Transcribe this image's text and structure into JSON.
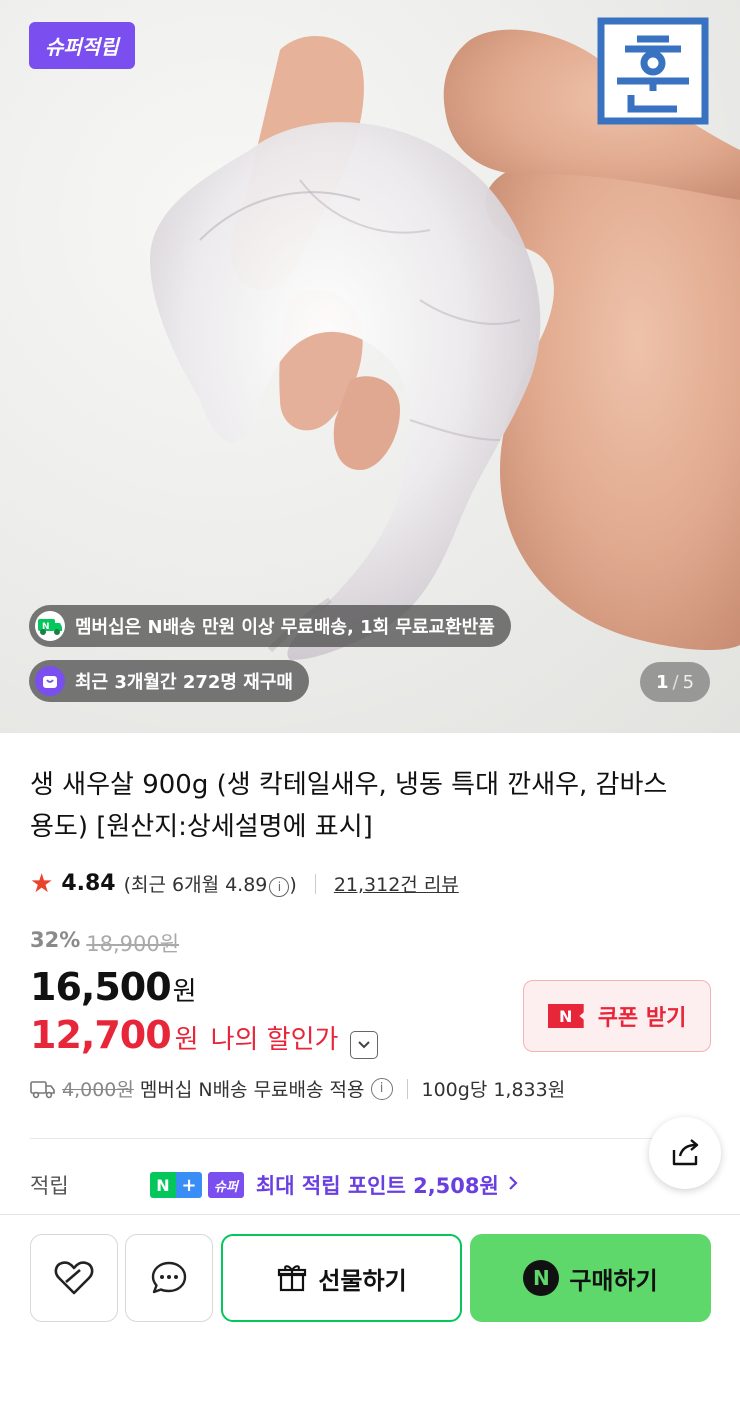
{
  "hero": {
    "badge": "슈퍼적립",
    "brand_logo_text": "훈",
    "pill_membership": "멤버십은 N배송 만원 이상 무료배송, 1회 무료교환반품",
    "pill_rebuy": "최근 3개월간 272명 재구매",
    "pager_current": "1",
    "pager_sep": "/",
    "pager_total": "5"
  },
  "product": {
    "title": "생 새우살 900g (생 칵테일새우, 냉동 특대 깐새우, 감바스용도) [원산지:상세설명에 표시]",
    "rating": "4.84",
    "recent_rating": "(최근 6개월 4.89",
    "recent_close": ")",
    "reviews": "21,312건 리뷰",
    "discount_pct": "32%",
    "original_price": "18,900원",
    "price": "16,500",
    "price_unit": "원",
    "my_price": "12,700",
    "my_price_unit": "원",
    "my_price_label": "나의 할인가",
    "coupon_button": "쿠폰 받기",
    "coupon_icon": "N",
    "ship_orig": "4,000원",
    "ship_text": "멤버십 N배송 무료배송 적용",
    "unit_price": "100g당 1,833원",
    "points_label": "적립",
    "points_chip_n": "N",
    "points_chip_plus": "+",
    "points_chip_super": "슈퍼",
    "points_text": "최대 적립 포인트 2,508원"
  },
  "actions": {
    "gift": "선물하기",
    "buy": "구매하기",
    "buy_icon": "N"
  },
  "colors": {
    "accent_red": "#e8263a",
    "naver_green": "#03c75a",
    "buy_green": "#5ed86b",
    "super_purple": "#7b4ef0"
  }
}
